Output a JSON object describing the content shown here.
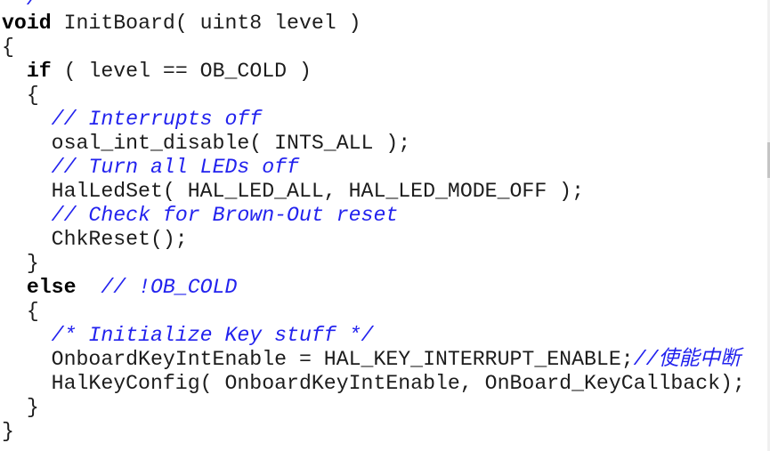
{
  "editor": {
    "colors": {
      "keyword": "#000000",
      "comment": "#2222ee",
      "text": "#1c1c1c"
    },
    "lines": [
      [
        {
          "t": " */",
          "c": "cm"
        }
      ],
      [
        {
          "t": "void",
          "c": "kw"
        },
        {
          "t": " InitBoard( uint8 level )",
          "c": "tx"
        }
      ],
      [
        {
          "t": "{",
          "c": "tx"
        }
      ],
      [
        {
          "t": "  ",
          "c": "tx"
        },
        {
          "t": "if",
          "c": "kw"
        },
        {
          "t": " ( level == OB_COLD )",
          "c": "tx"
        }
      ],
      [
        {
          "t": "  {",
          "c": "tx"
        }
      ],
      [
        {
          "t": "    ",
          "c": "tx"
        },
        {
          "t": "// Interrupts off",
          "c": "cm"
        }
      ],
      [
        {
          "t": "    osal_int_disable( INTS_ALL );",
          "c": "tx"
        }
      ],
      [
        {
          "t": "    ",
          "c": "tx"
        },
        {
          "t": "// Turn all LEDs off",
          "c": "cm"
        }
      ],
      [
        {
          "t": "    HalLedSet( HAL_LED_ALL, HAL_LED_MODE_OFF );",
          "c": "tx"
        }
      ],
      [
        {
          "t": "    ",
          "c": "tx"
        },
        {
          "t": "// Check for Brown-Out reset",
          "c": "cm"
        }
      ],
      [
        {
          "t": "    ChkReset();",
          "c": "tx"
        }
      ],
      [
        {
          "t": "  }",
          "c": "tx"
        }
      ],
      [
        {
          "t": "  ",
          "c": "tx"
        },
        {
          "t": "else",
          "c": "kw"
        },
        {
          "t": "  ",
          "c": "tx"
        },
        {
          "t": "// !OB_COLD",
          "c": "cm"
        }
      ],
      [
        {
          "t": "  {",
          "c": "tx"
        }
      ],
      [
        {
          "t": "    ",
          "c": "tx"
        },
        {
          "t": "/* Initialize Key stuff */",
          "c": "cm"
        }
      ],
      [
        {
          "t": "    OnboardKeyIntEnable = HAL_KEY_INTERRUPT_ENABLE;",
          "c": "tx"
        },
        {
          "t": "//使能中断",
          "c": "cm"
        }
      ],
      [
        {
          "t": "    HalKeyConfig( OnboardKeyIntEnable, OnBoard_KeyCallback);",
          "c": "tx"
        }
      ],
      [
        {
          "t": "  }",
          "c": "tx"
        }
      ],
      [
        {
          "t": "}",
          "c": "tx"
        }
      ]
    ]
  }
}
